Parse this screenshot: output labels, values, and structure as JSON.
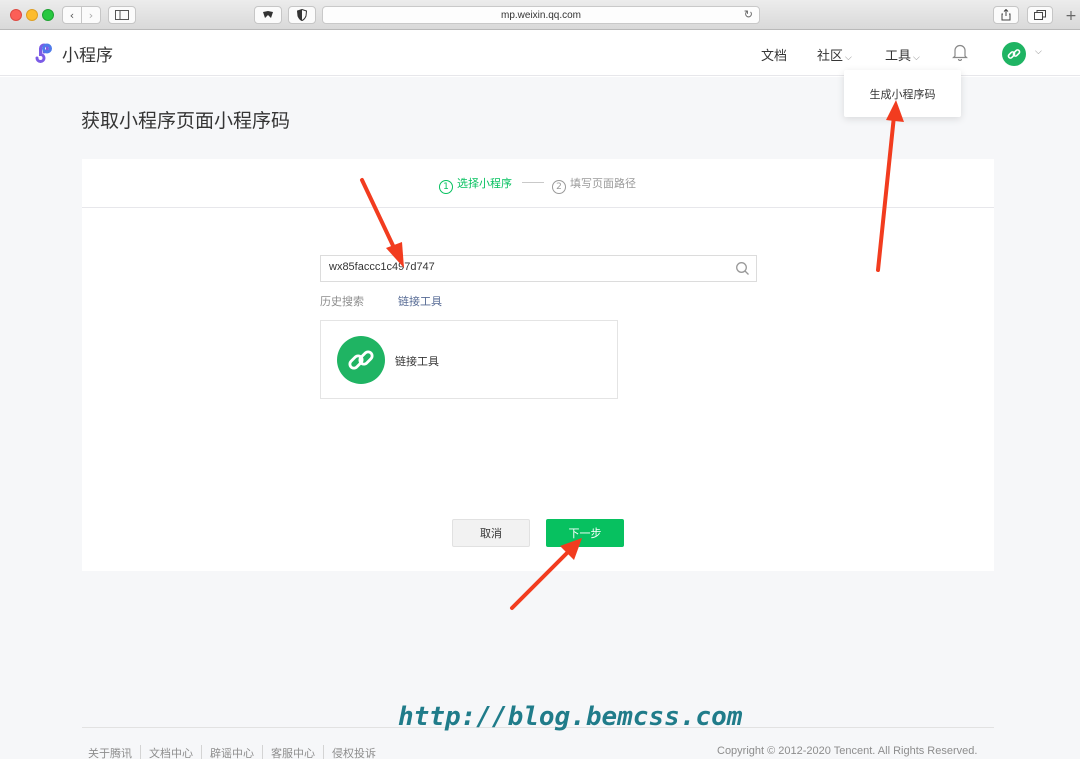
{
  "browser": {
    "url": "mp.weixin.qq.com"
  },
  "header": {
    "logo_text": "小程序",
    "nav": {
      "docs": "文档",
      "community": "社区",
      "tools": "工具"
    },
    "dropdown_item": "生成小程序码"
  },
  "main": {
    "title": "获取小程序页面小程序码",
    "steps": [
      {
        "num": "1",
        "label": "选择小程序",
        "state": "active"
      },
      {
        "num": "2",
        "label": "填写页面路径",
        "state": "pending"
      }
    ],
    "search": {
      "value": "wx85faccc1c497d747"
    },
    "history_label": "历史搜索",
    "history_link": "链接工具",
    "result_name": "链接工具",
    "buttons": {
      "cancel": "取消",
      "next": "下一步"
    }
  },
  "footer": {
    "links": [
      "关于腾讯",
      "文档中心",
      "辟谣中心",
      "客服中心",
      "侵权投诉"
    ],
    "copyright": "Copyright © 2012-2020 Tencent. All Rights Reserved."
  },
  "watermark": "http://blog.bemcss.com",
  "colors": {
    "brand_green": "#07c160",
    "link_blue": "#576b95",
    "arrow_red": "#f23c1f"
  }
}
